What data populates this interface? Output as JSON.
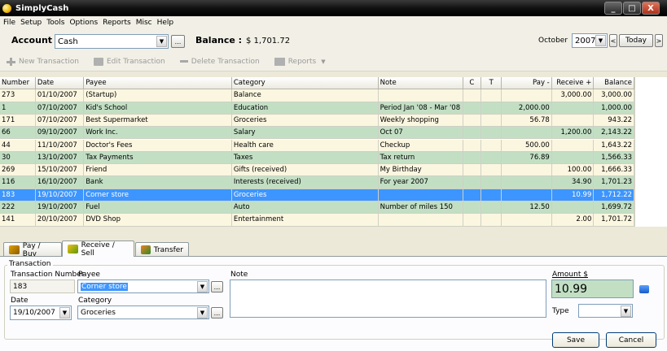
{
  "window": {
    "title": "SimplyCash",
    "min": "_",
    "max": "□",
    "close": "X"
  },
  "menu": [
    "File",
    "Setup",
    "Tools",
    "Options",
    "Reports",
    "Misc",
    "Help"
  ],
  "account": {
    "label": "Account",
    "value": "Cash",
    "browse": "...",
    "balance_label": "Balance :",
    "balance": "$ 1,701.72",
    "month": "October",
    "year": "2007",
    "today": "Today",
    "prev": "<",
    "next": ">"
  },
  "toolbar": {
    "new": "New Transaction",
    "edit": "Edit Transaction",
    "delete": "Delete Transaction",
    "reports": "Reports"
  },
  "columns": [
    "Number",
    "Date",
    "Payee",
    "Category",
    "Note",
    "C",
    "T",
    "Pay -",
    "Receive +",
    "Balance"
  ],
  "rows": [
    [
      "273",
      "01/10/2007",
      "(Startup)",
      "Balance",
      "",
      "",
      "",
      "",
      "3,000.00",
      "3,000.00"
    ],
    [
      "1",
      "07/10/2007",
      "Kid's School",
      "Education",
      "Period Jan '08 - Mar '08",
      "",
      "",
      "2,000.00",
      "",
      "1,000.00"
    ],
    [
      "171",
      "07/10/2007",
      "Best Supermarket",
      "Groceries",
      "Weekly shopping",
      "",
      "",
      "56.78",
      "",
      "943.22"
    ],
    [
      "66",
      "09/10/2007",
      "Work Inc.",
      "Salary",
      "Oct 07",
      "",
      "",
      "",
      "1,200.00",
      "2,143.22"
    ],
    [
      "44",
      "11/10/2007",
      "Doctor's Fees",
      "Health care",
      "Checkup",
      "",
      "",
      "500.00",
      "",
      "1,643.22"
    ],
    [
      "30",
      "13/10/2007",
      "Tax Payments",
      "Taxes",
      "Tax return",
      "",
      "",
      "76.89",
      "",
      "1,566.33"
    ],
    [
      "269",
      "15/10/2007",
      "Friend",
      "Gifts (received)",
      "My Birthday",
      "",
      "",
      "",
      "100.00",
      "1,666.33"
    ],
    [
      "116",
      "16/10/2007",
      "Bank",
      "Interests (received)",
      "For year 2007",
      "",
      "",
      "",
      "34.90",
      "1,701.23"
    ],
    [
      "183",
      "19/10/2007",
      "Corner store",
      "Groceries",
      "",
      "",
      "",
      "",
      "10.99",
      "1,712.22"
    ],
    [
      "222",
      "19/10/2007",
      "Fuel",
      "Auto",
      "Number of miles 150",
      "",
      "",
      "12.50",
      "",
      "1,699.72"
    ],
    [
      "141",
      "20/10/2007",
      "DVD Shop",
      "Entertainment",
      "",
      "",
      "",
      "",
      "2.00",
      "1,701.72"
    ]
  ],
  "tabs": [
    "Pay / Buy",
    "Receive / Sell",
    "Transfer"
  ],
  "form": {
    "group": "Transaction",
    "number_label": "Transaction Number",
    "number": "183",
    "payee_label": "Payee",
    "payee": "Corner store",
    "date_label": "Date",
    "date": "19/10/2007",
    "category_label": "Category",
    "category": "Groceries",
    "note_label": "Note",
    "amount_label": "Amount $",
    "amount": "10.99",
    "type_label": "Type",
    "type": "",
    "save": "Save",
    "cancel": "Cancel",
    "ellipsis": "..."
  },
  "colors": {
    "row_light": "#fbf6e0",
    "row_green": "#c2dfc4",
    "selected": "#3d95ff",
    "amount_bg": "#c2dfc4"
  }
}
